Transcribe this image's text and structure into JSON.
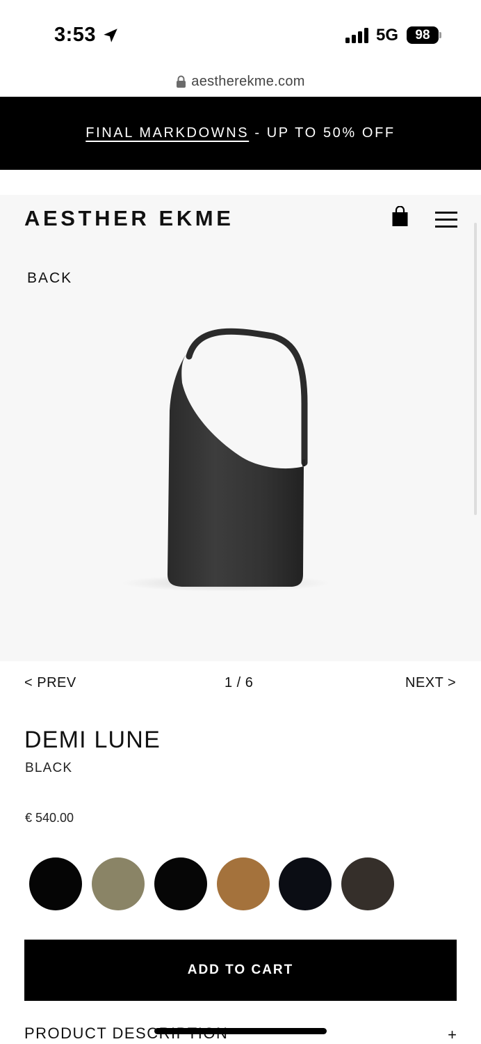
{
  "status_bar": {
    "time": "3:53",
    "network": "5G",
    "battery": "98"
  },
  "browser": {
    "url": "aestherekme.com"
  },
  "promo": {
    "link_text": "FINAL MARKDOWNS",
    "rest_text": " - UP TO 50% OFF"
  },
  "header": {
    "brand": "AESTHER EKME",
    "icons": [
      "shopping-bag-icon",
      "hamburger-menu-icon"
    ]
  },
  "nav": {
    "back_label": "BACK",
    "prev_label": "< PREV",
    "counter": "1 / 6",
    "next_label": "NEXT >"
  },
  "product": {
    "name": "DEMI LUNE",
    "color": "BLACK",
    "price": "€ 540.00",
    "swatch_colors": [
      "#050505",
      "#8a8466",
      "#060606",
      "#a4723c",
      "#0b0d14",
      "#352f2a"
    ],
    "add_to_cart_label": "ADD TO CART",
    "description_label": "PRODUCT DESCRIPTION",
    "description_toggle": "+"
  }
}
